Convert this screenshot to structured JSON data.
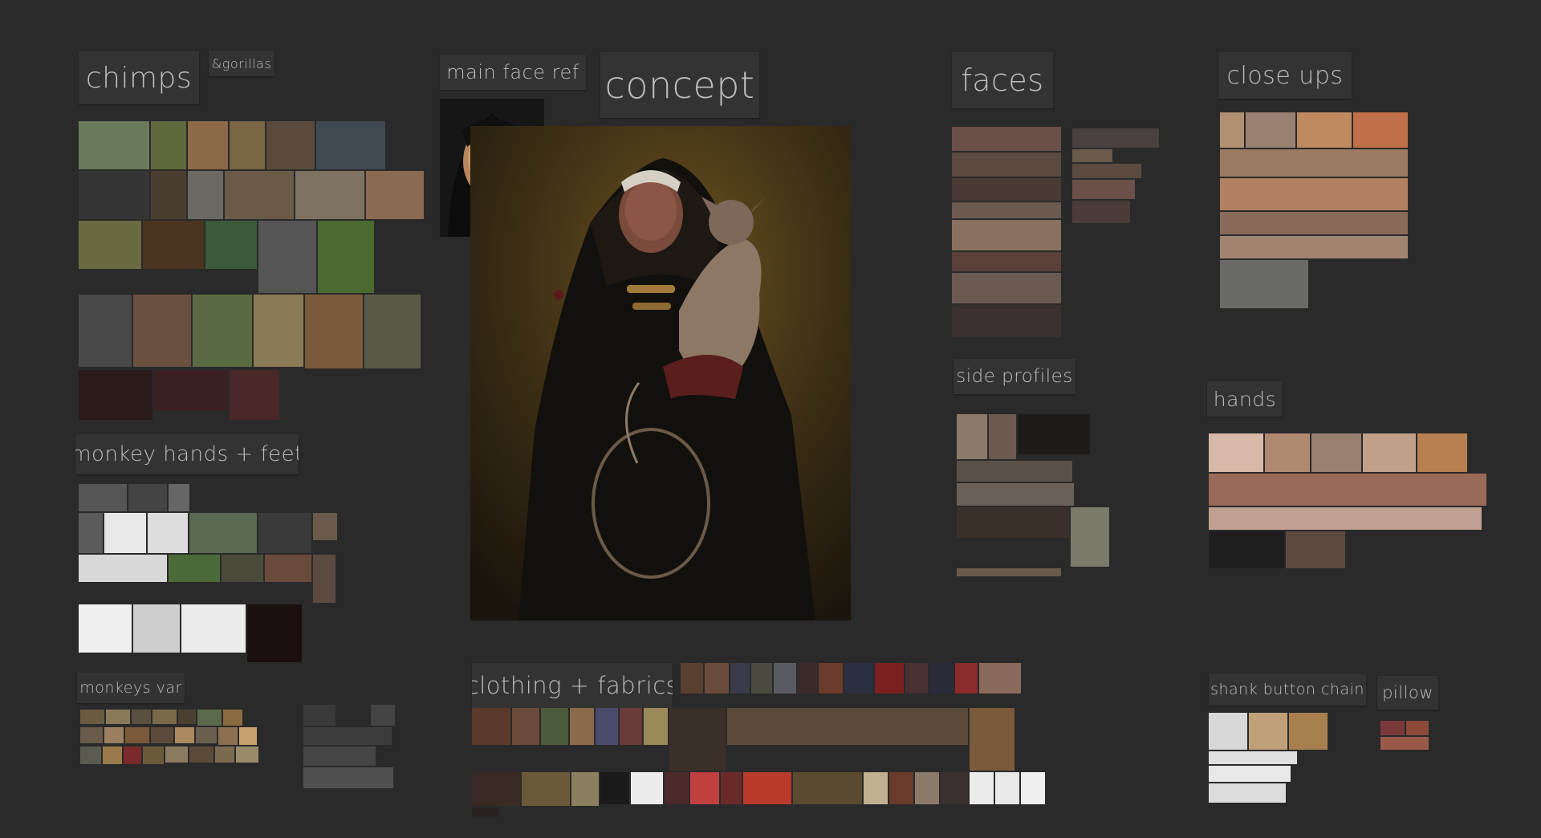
{
  "board": {
    "background": "#2a2a2a",
    "labels": {
      "chimps": "chimps",
      "gorillas": "&gorillas",
      "monkey_hands_feet": "monkey hands + feet",
      "monkeys_var": "monkeys var",
      "main_face_ref": "main face ref",
      "concept": "concept",
      "clothing_fabrics": "clothing + fabrics",
      "faces": "faces",
      "side_profiles": "side profiles",
      "close_ups": "close ups",
      "hands": "hands",
      "shank_button_chain": "shank button chain",
      "pillow": "pillow"
    }
  }
}
